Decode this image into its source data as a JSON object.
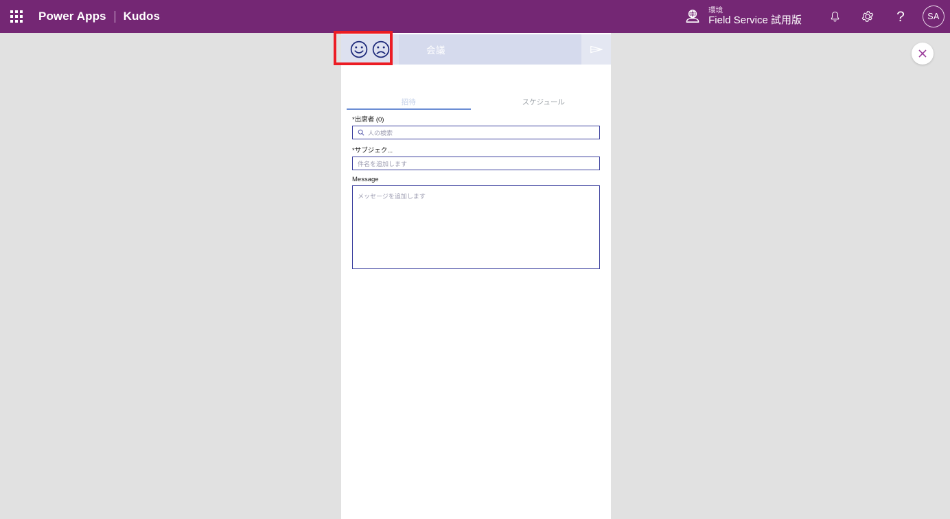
{
  "appbar": {
    "waffle_icon": "app-launcher-grid-icon",
    "product": "Power Apps",
    "separator": "|",
    "app_name": "Kudos",
    "environment": {
      "icon": "environment-globe-icon",
      "label": "環境",
      "name": "Field Service 試用版"
    },
    "notifications_icon": "bell-icon",
    "settings_icon": "gear-icon",
    "help_icon": "question-mark-icon",
    "help_glyph": "?",
    "avatar_initials": "SA",
    "brand_color": "#742774"
  },
  "panel": {
    "compose": {
      "mood_icons": [
        "smiley-face-icon",
        "frowning-face-icon"
      ],
      "title": "会議",
      "send_icon": "send-paper-plane-icon"
    },
    "tabs": [
      {
        "label": "招待",
        "active": true
      },
      {
        "label": "スケジュール",
        "active": false
      }
    ],
    "form": {
      "attendees": {
        "label": "*出席者 (0)",
        "placeholder": "人の検索",
        "value": "",
        "icon": "search-icon"
      },
      "subject": {
        "label": "*サブジェク...",
        "placeholder": "件名を追加します",
        "value": ""
      },
      "message": {
        "label": "Message",
        "placeholder": "メッセージを追加します",
        "value": ""
      }
    }
  },
  "close_button": {
    "icon": "close-x-icon",
    "color": "#9b3d9b"
  },
  "annotation": {
    "highlight_color": "#ec1c24",
    "target": "mood-selector-button"
  }
}
